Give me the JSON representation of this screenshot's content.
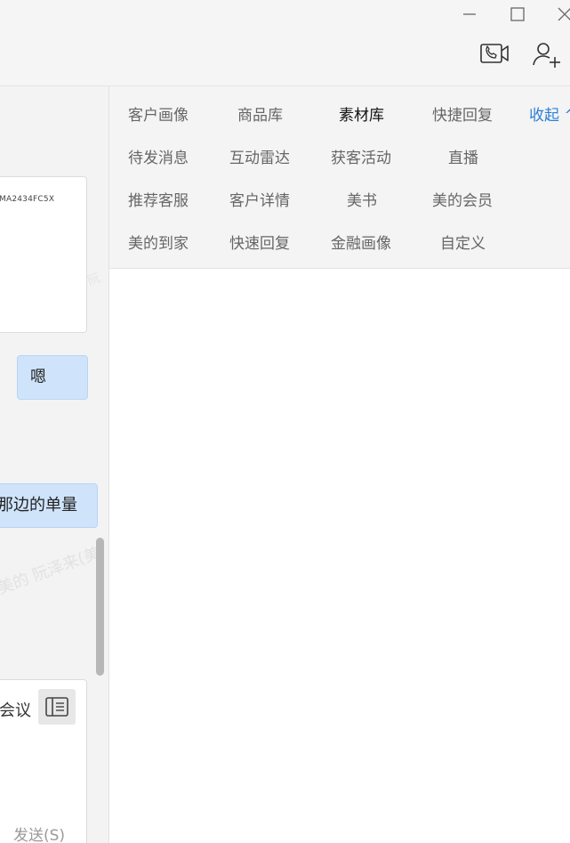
{
  "window": {
    "minimize_icon": "minimize-icon",
    "maximize_icon": "maximize-icon",
    "close_icon": "close-icon"
  },
  "header_actions": [
    {
      "icon": "video-call-icon"
    },
    {
      "icon": "add-user-icon"
    }
  ],
  "chat": {
    "card_code": "MA2434FC5X",
    "messages": [
      "嗯",
      "那边的单量"
    ],
    "watermark": "美的 阮泽来(美",
    "watermark_small": "组-阮",
    "draft_text": "会议",
    "send_label": "发送(S)"
  },
  "toolbar": {
    "rows": [
      [
        "客户画像",
        "商品库",
        "素材库",
        "快捷回复"
      ],
      [
        "待发消息",
        "互动雷达",
        "获客活动",
        "直播"
      ],
      [
        "推荐客服",
        "客户详情",
        "美书",
        "美的会员"
      ],
      [
        "美的到家",
        "快速回复",
        "金融画像",
        "自定义"
      ]
    ],
    "active": "素材库",
    "collapse_label": "收起 ^"
  },
  "colors": {
    "accent": "#2b7fd6",
    "bubble": "#cfe4fb",
    "background": "#f3f3f3"
  }
}
